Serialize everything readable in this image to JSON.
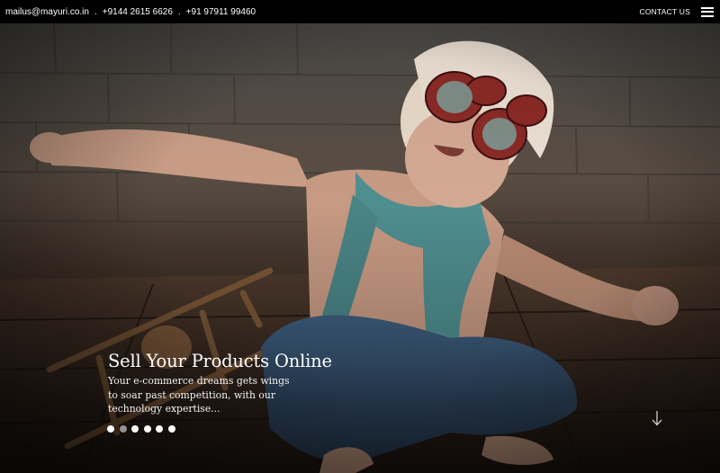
{
  "topbar": {
    "email": "mailus@mayuri.co.in",
    "separator": ".",
    "phone1": "+9144 2615 6626",
    "phone2": "+91 97911 99460",
    "contact_label": "CONTACT US",
    "menu_icon": "hamburger-menu-icon"
  },
  "hero": {
    "title": "Sell Your Products Online",
    "text": "Your e-commerce dreams gets wings to soar past competition, with our technology expertise...",
    "slide_count": 6,
    "active_slide": 1,
    "scroll_icon": "arrow-down-icon"
  },
  "colors": {
    "topbar_bg": "#000000",
    "text": "#ffffff"
  }
}
